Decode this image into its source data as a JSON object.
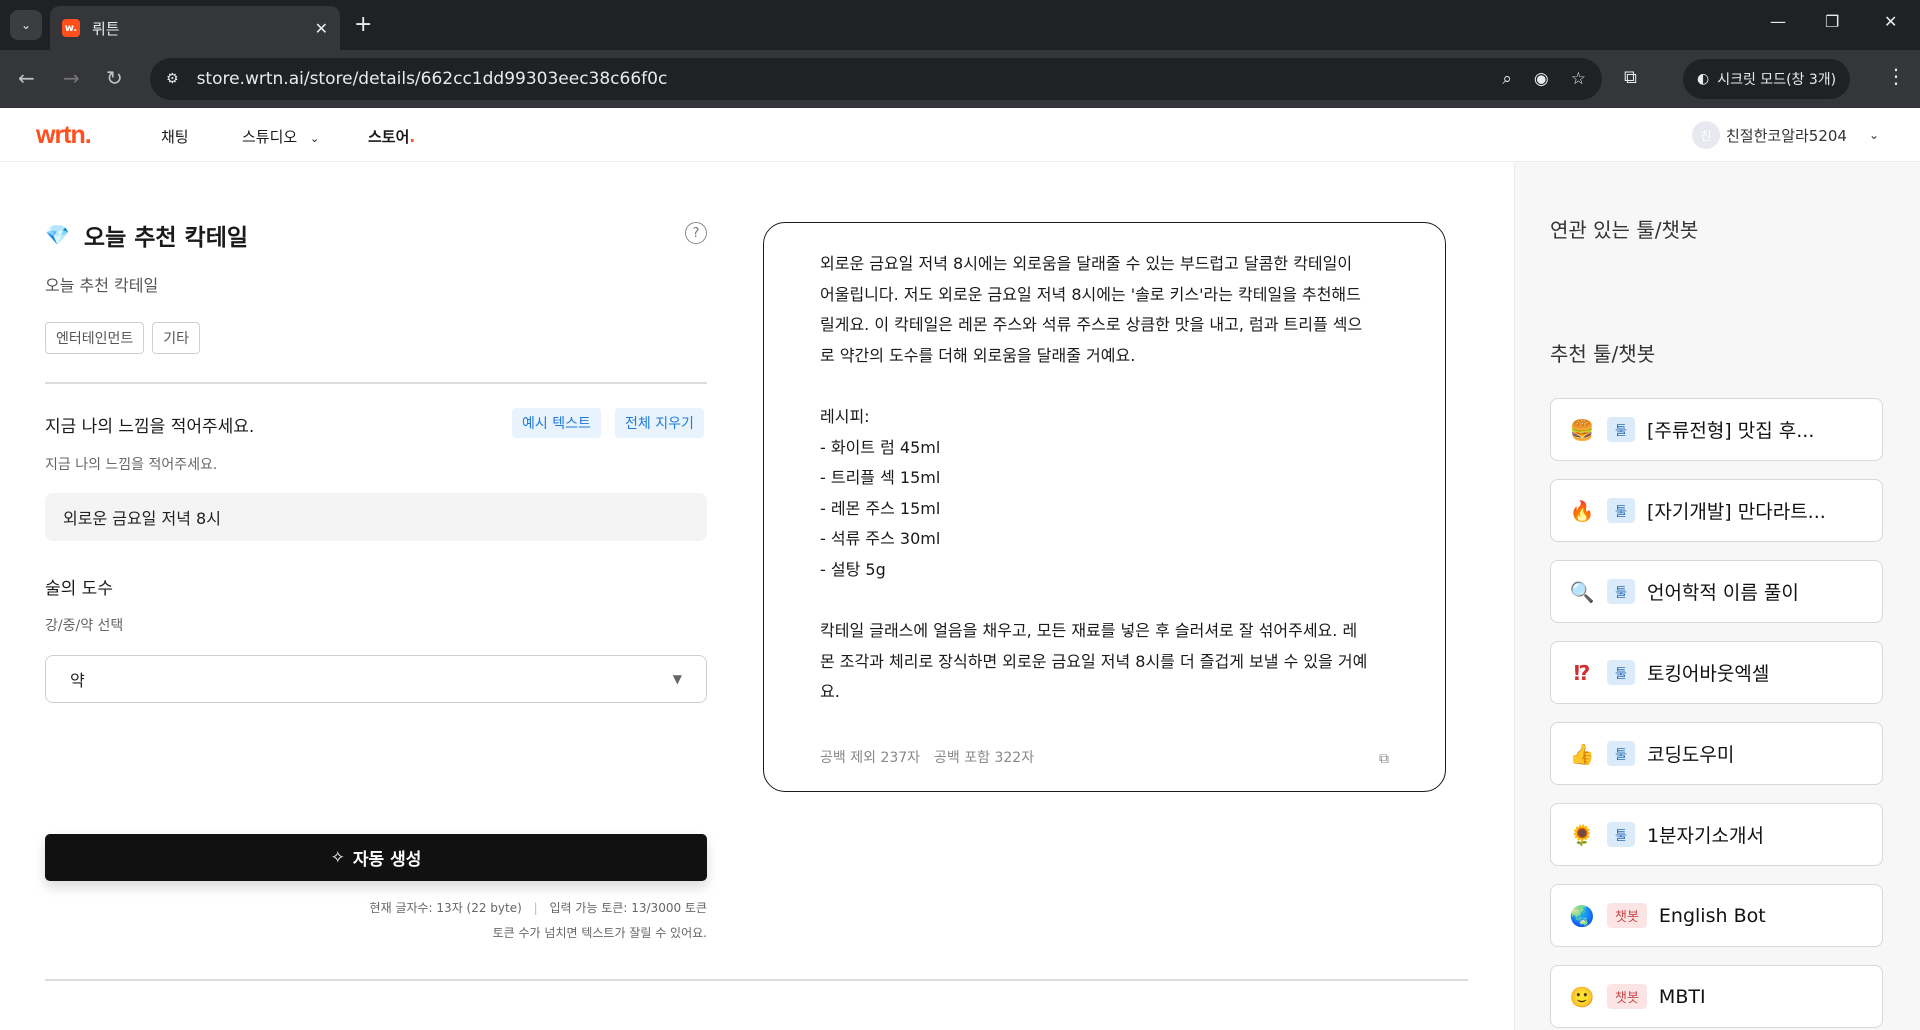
{
  "browser": {
    "tab_title": "뤼튼",
    "url": "store.wrtn.ai/store/details/662cc1dd99303eec38c66f0c",
    "incognito_label": "시크릿 모드(창 3개)"
  },
  "header": {
    "logo": "wrtn.",
    "nav": {
      "chat": "채팅",
      "studio": "스튜디오",
      "store": "스토어"
    },
    "username": "친절한코알라5204",
    "avatar_text": "친"
  },
  "tool": {
    "title": "오늘 추천 칵테일",
    "description": "오늘 추천 칵테일",
    "tags": [
      "엔터테인먼트",
      "기타"
    ]
  },
  "form": {
    "feeling_label": "지금 나의 느낌을 적어주세요.",
    "feeling_help": "지금 나의 느낌을 적어주세요.",
    "example_text_btn": "예시 텍스트",
    "clear_all_btn": "전체 지우기",
    "feeling_value": "외로운 금요일 저녁 8시",
    "strength_label": "술의 도수",
    "strength_help": "강/중/약 선택",
    "strength_value": "약",
    "generate_btn": "자동 생성",
    "char_count": "현재 글자수: 13자 (22 byte)",
    "token_count": "입력 가능 토큰: 13/3000 토큰",
    "token_warning": "토큰 수가 넘치면 텍스트가 잘릴 수 있어요."
  },
  "result": {
    "text": "외로운 금요일 저녁 8시에는 외로움을 달래줄 수 있는 부드럽고 달콤한 칵테일이\n어울립니다. 저도 외로운 금요일 저녁 8시에는 '솔로 키스'라는 칵테일을 추천해드\n릴게요. 이 칵테일은 레몬 주스와 석류 주스로 상큼한 맛을 내고, 럼과 트리플 섹으\n로 약간의 도수를 더해 외로움을 달래줄 거예요.\n\n레시피:\n- 화이트 럼 45ml\n- 트리플 섹 15ml\n- 레몬 주스 15ml\n- 석류 주스 30ml\n- 설탕 5g\n\n칵테일 글래스에 얼음을 채우고, 모든 재료를 넣은 후 슬러셔로 잘 섞어주세요. 레\n몬 조각과 체리로 장식하면 외로운 금요일 저녁 8시를 더 즐겁게 보낼 수 있을 거예\n요.",
    "count_no_space_label": "공백 제외",
    "count_no_space": "237자",
    "count_with_space_label": "공백 포함",
    "count_with_space": "322자"
  },
  "sidebar": {
    "related_heading": "연관 있는 툴/챗봇",
    "recommended_heading": "추천 툴/챗봇",
    "items": [
      {
        "emoji": "🍔",
        "type": "툴",
        "name": "[주류전형] 맛집 후...",
        "kind": "tool"
      },
      {
        "emoji": "🔥",
        "type": "툴",
        "name": "[자기개발] 만다라트...",
        "kind": "tool"
      },
      {
        "emoji": "🔍",
        "type": "툴",
        "name": "언어학적 이름 풀이",
        "kind": "tool"
      },
      {
        "emoji": "⁉",
        "type": "툴",
        "name": "토킹어바웃엑셀",
        "kind": "tool"
      },
      {
        "emoji": "👍",
        "type": "툴",
        "name": "코딩도우미",
        "kind": "tool"
      },
      {
        "emoji": "🌻",
        "type": "툴",
        "name": "1분자기소개서",
        "kind": "tool"
      },
      {
        "emoji": "🌏",
        "type": "챗봇",
        "name": "English Bot",
        "kind": "bot"
      },
      {
        "emoji": "🙂",
        "type": "챗봇",
        "name": "MBTI",
        "kind": "bot"
      }
    ]
  },
  "colors": {
    "brand": "#ff4f1f",
    "chip_blue": "#1f7ad8"
  }
}
